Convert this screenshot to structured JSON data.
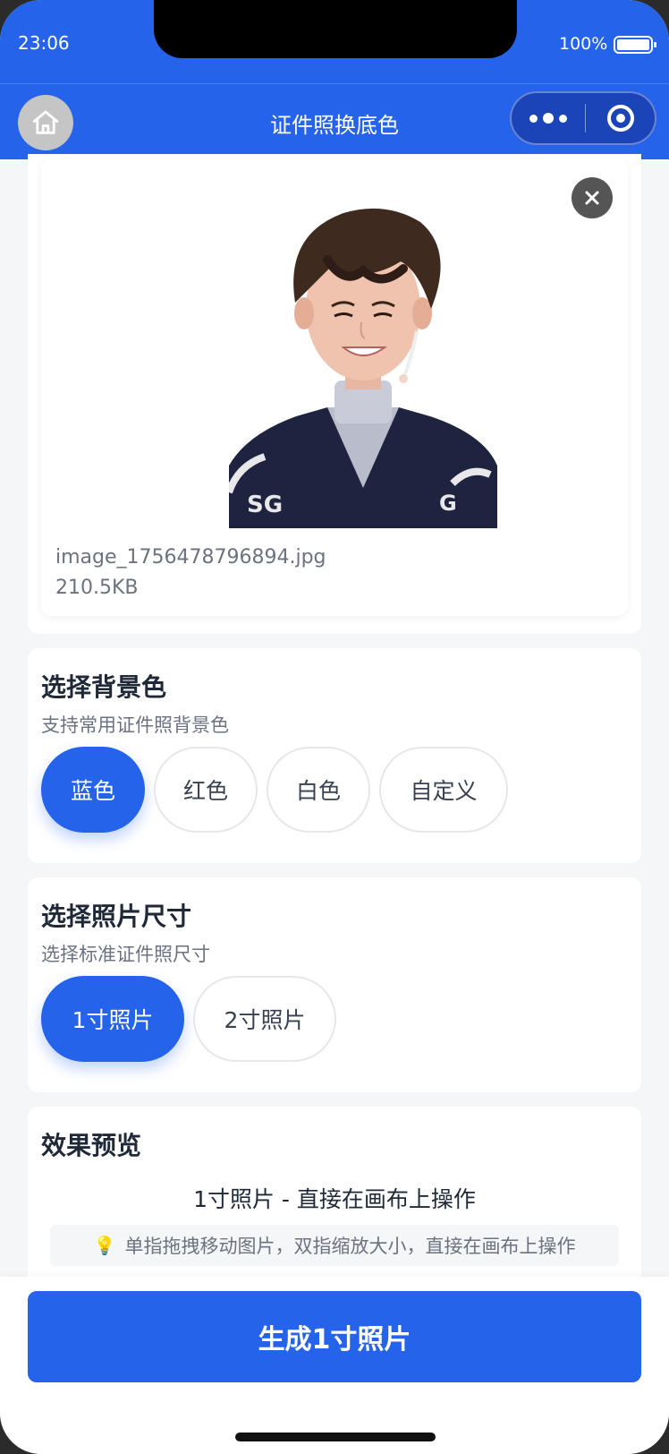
{
  "status": {
    "time": "23:06",
    "battery": "100%"
  },
  "nav": {
    "title": "证件照换底色"
  },
  "photo": {
    "file_name": "image_1756478796894.jpg",
    "file_size": "210.5KB"
  },
  "background": {
    "title": "选择背景色",
    "subtitle": "支持常用证件照背景色",
    "options": [
      "蓝色",
      "红色",
      "白色",
      "自定义"
    ],
    "selected": "蓝色"
  },
  "size": {
    "title": "选择照片尺寸",
    "subtitle": "选择标准证件照尺寸",
    "options": [
      "1寸照片",
      "2寸照片"
    ],
    "selected": "1寸照片"
  },
  "preview": {
    "title": "效果预览",
    "label": "1寸照片 - 直接在画布上操作",
    "tip": "单指拖拽移动图片，双指缩放大小，直接在画布上操作"
  },
  "actions": {
    "generate_label": "生成1寸照片"
  },
  "colors": {
    "primary": "#2563eb",
    "accent_bulb": "#f59e0b"
  }
}
